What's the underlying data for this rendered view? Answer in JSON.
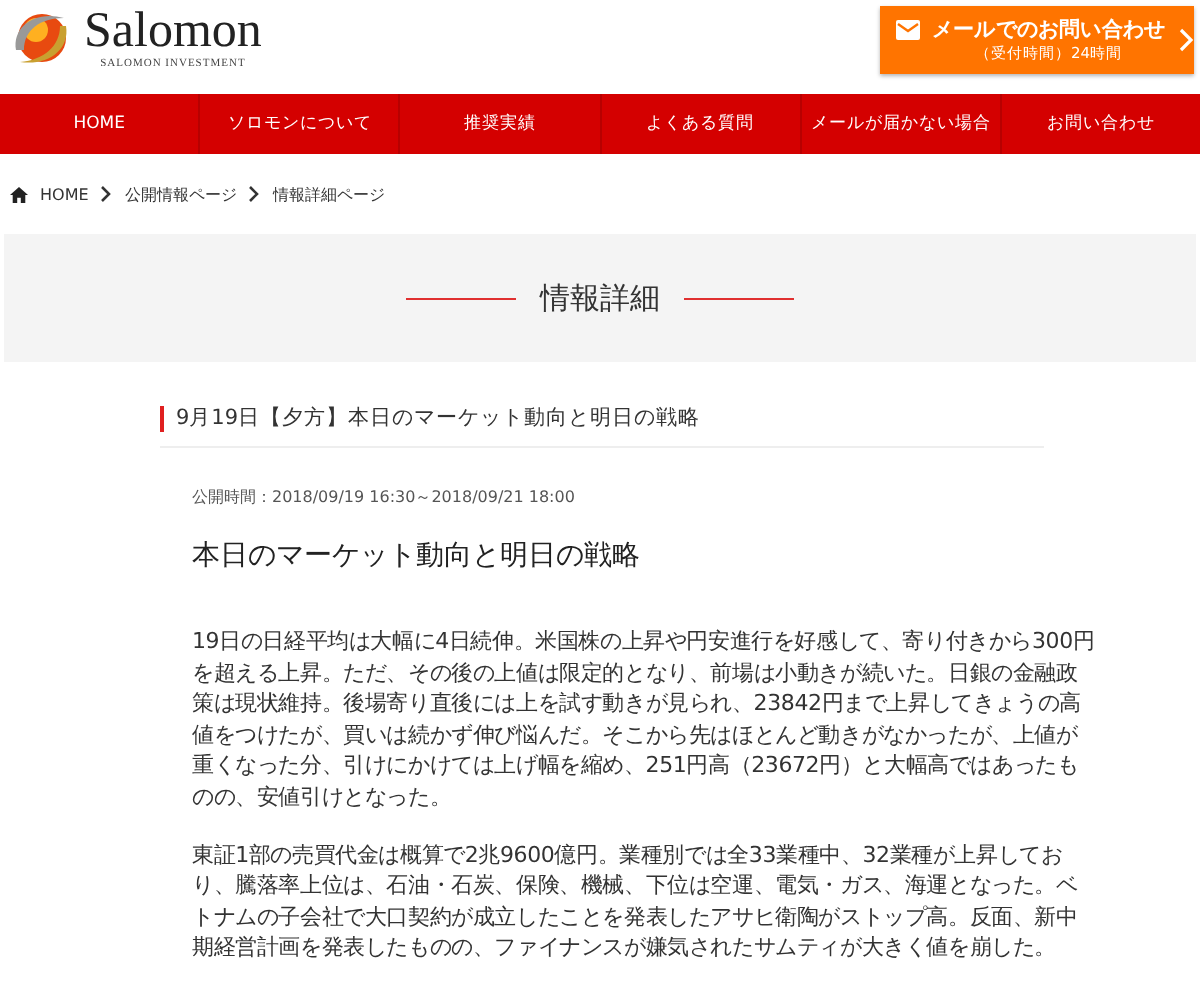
{
  "header": {
    "logo": {
      "name": "Salomon",
      "tagline": "SALOMON INVESTMENT"
    },
    "contact_button": {
      "label": "メールでのお問い合わせ",
      "hours": "（受付時間）24時間"
    }
  },
  "nav": [
    {
      "label": "HOME"
    },
    {
      "label": "ソロモンについて"
    },
    {
      "label": "推奨実績"
    },
    {
      "label": "よくある質問"
    },
    {
      "label": "メールが届かない場合"
    },
    {
      "label": "お問い合わせ"
    }
  ],
  "breadcrumb": [
    {
      "label": "HOME"
    },
    {
      "label": "公開情報ページ"
    },
    {
      "label": "情報詳細ページ"
    }
  ],
  "page_title": "情報詳細",
  "article": {
    "title": "9月19日【夕方】本日のマーケット動向と明日の戦略",
    "published": "公開時間：2018/09/19 16:30～2018/09/21 18:00",
    "heading": "本日のマーケット動向と明日の戦略",
    "paragraphs": [
      "19日の日経平均は大幅に4日続伸。米国株の上昇や円安進行を好感して、寄り付きから300円を超える上昇。ただ、その後の上値は限定的となり、前場は小動きが続いた。日銀の金融政策は現状維持。後場寄り直後には上を試す動きが見られ、23842円まで上昇してきょうの高値をつけたが、買いは続かず伸び悩んだ。そこから先はほとんど動きがなかったが、上値が重くなった分、引けにかけては上げ幅を縮め、251円高（23672円）と大幅高ではあったものの、安値引けとなった。",
      "東証1部の売買代金は概算で2兆9600億円。業種別では全33業種中、32業種が上昇しており、騰落率上位は、石油・石炭、保険、機械、下位は空運、電気・ガス、海運となった。ベトナムの子会社で大口契約が成立したことを発表したアサヒ衛陶がストップ高。反面、新中期経営計画を発表したものの、ファイナンスが嫌気されたサムティが大きく値を崩した。"
    ]
  }
}
